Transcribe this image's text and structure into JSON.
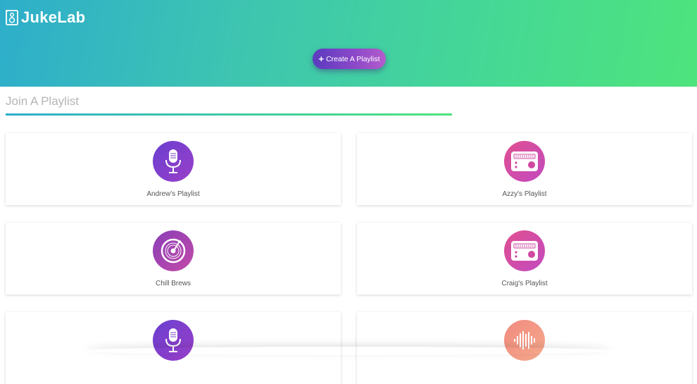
{
  "app": {
    "title": "JukeLab"
  },
  "header": {
    "create_label": "Create A Playlist"
  },
  "section": {
    "title": "Join A Playlist"
  },
  "colors": {
    "gradient_start": "#2eaecb",
    "gradient_end": "#4ee47c",
    "button": "#7a44c6"
  },
  "playlists": [
    {
      "label": "Andrew's Playlist",
      "icon": "microphone-icon"
    },
    {
      "label": "Azzy's Playlist",
      "icon": "radio-icon"
    },
    {
      "label": "Chill Brews",
      "icon": "vinyl-record-icon"
    },
    {
      "label": "Craig's Playlist",
      "icon": "radio-icon"
    },
    {
      "label": "",
      "icon": "microphone-icon"
    },
    {
      "label": "",
      "icon": "soundwave-icon"
    }
  ]
}
